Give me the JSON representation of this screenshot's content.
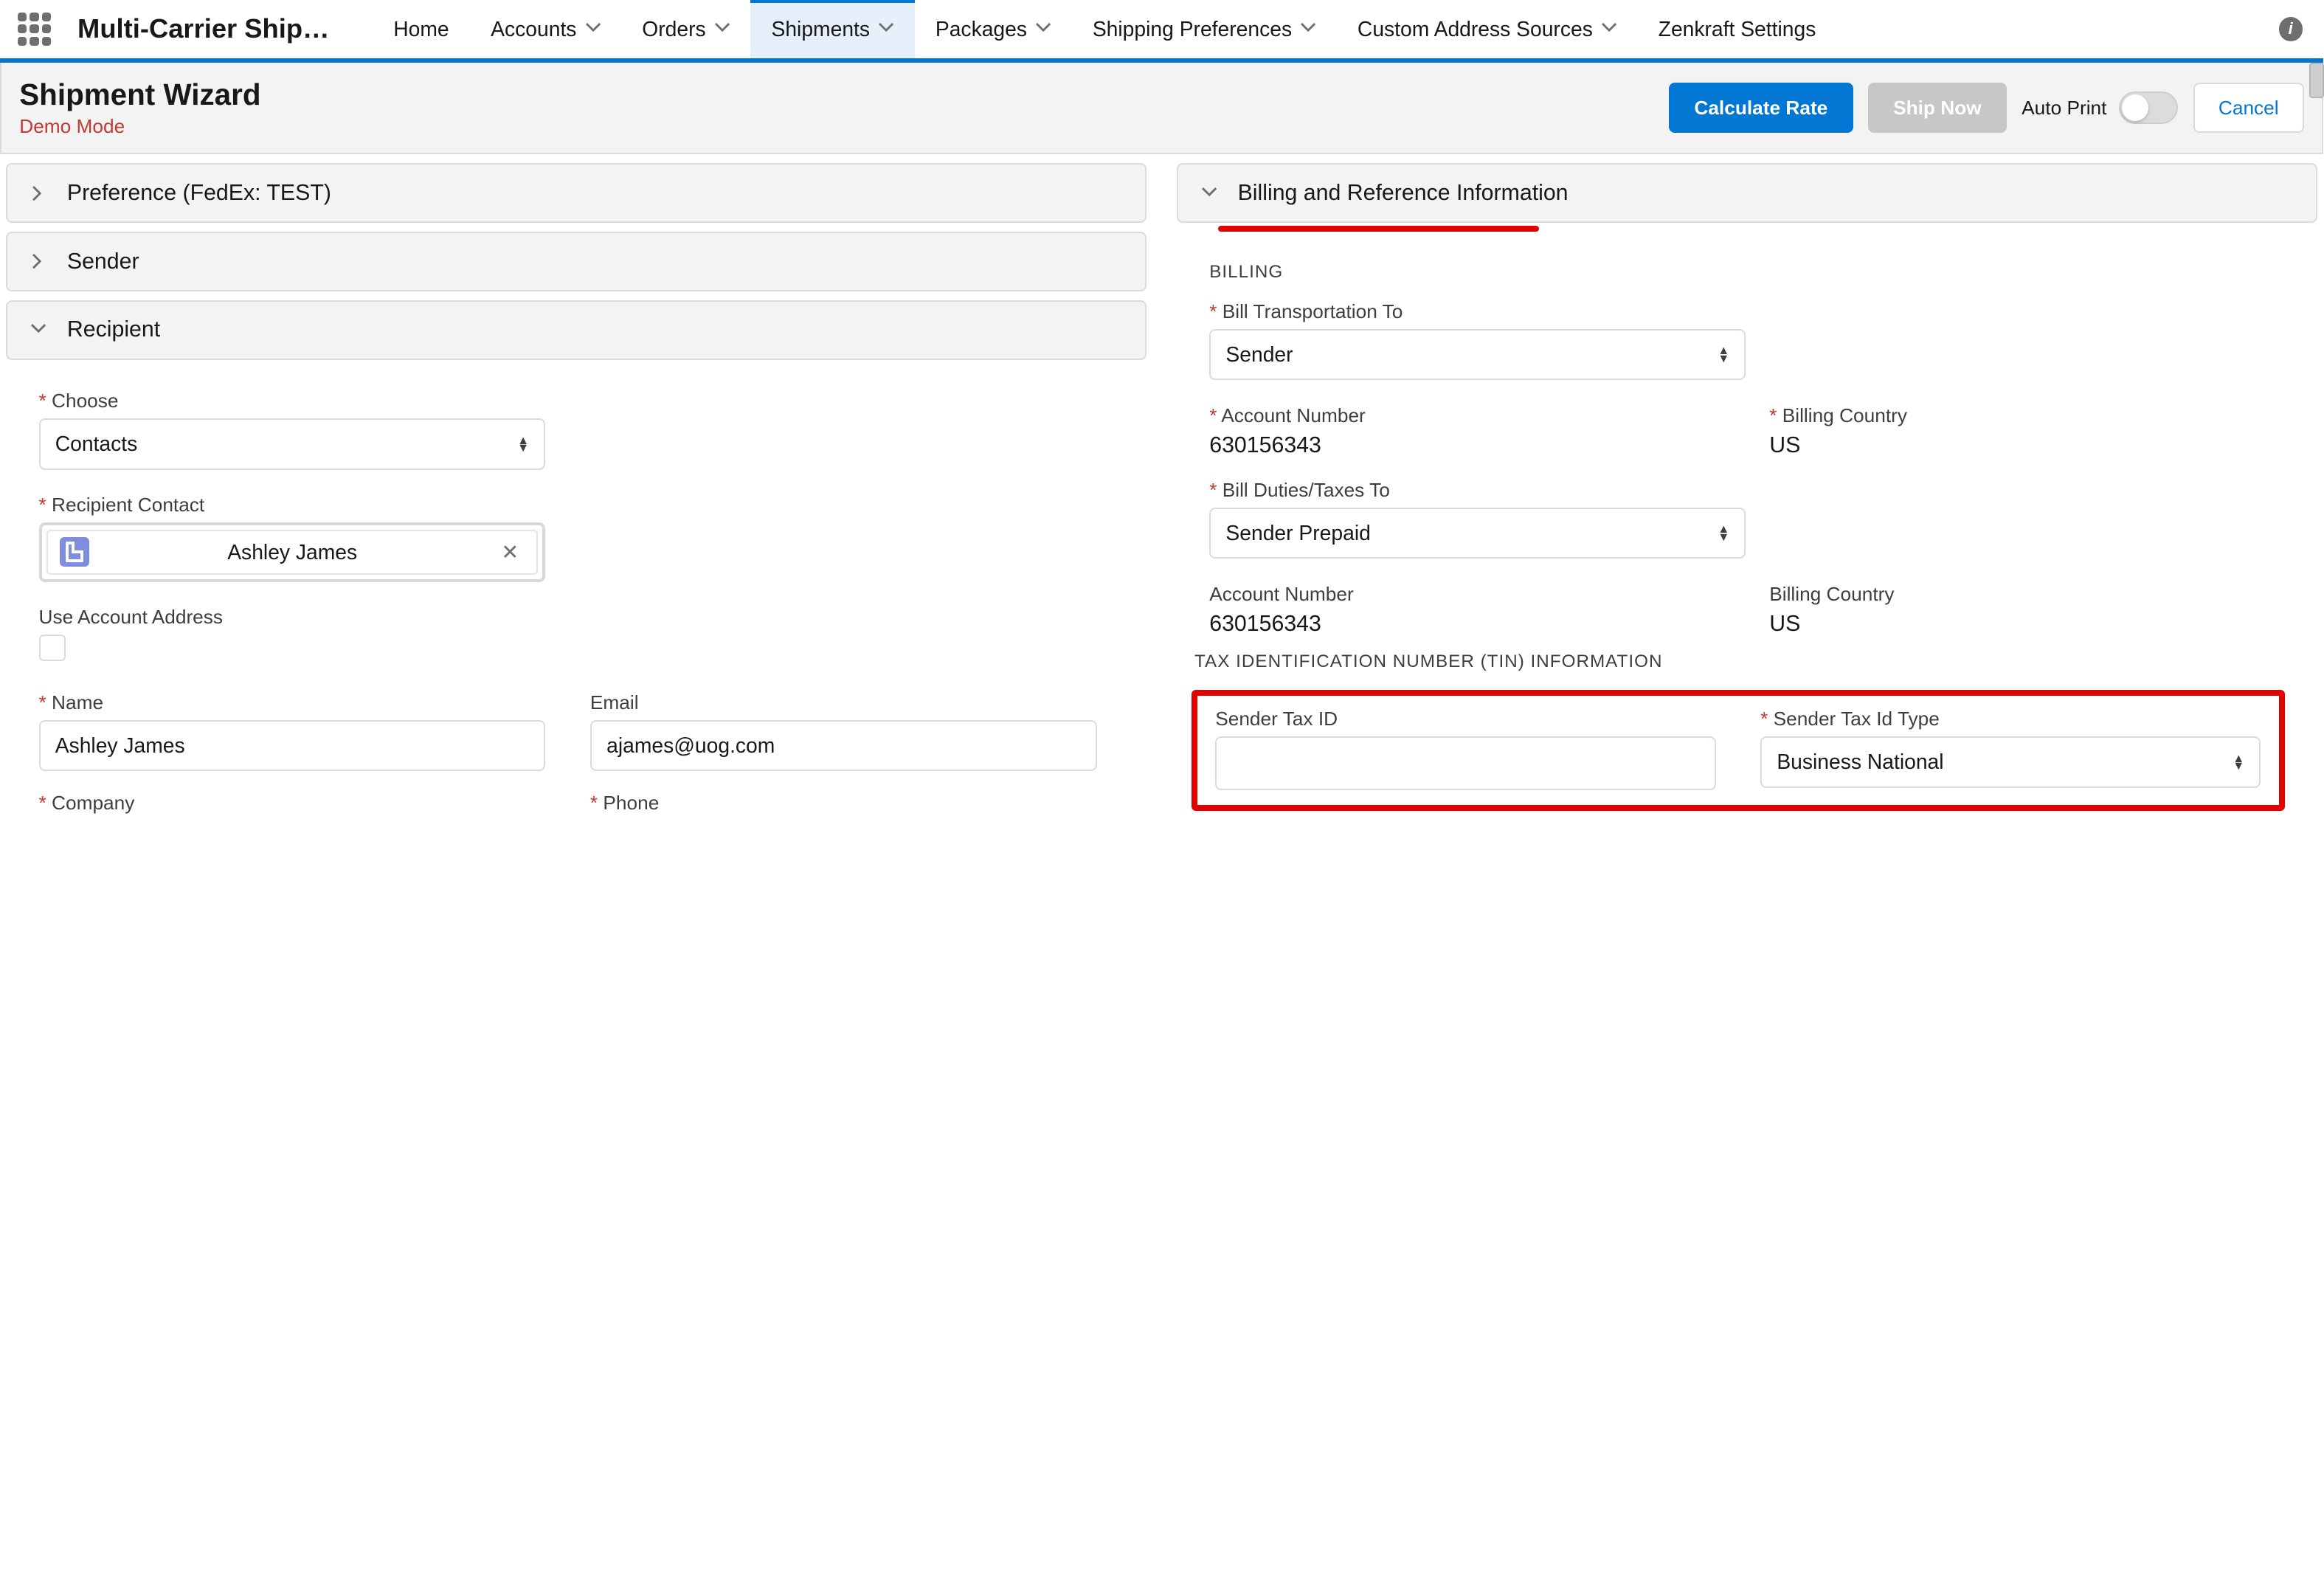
{
  "app": {
    "title": "Multi-Carrier Shippi…"
  },
  "nav": {
    "home": "Home",
    "accounts": "Accounts",
    "orders": "Orders",
    "shipments": "Shipments",
    "packages": "Packages",
    "shipping_prefs": "Shipping Preferences",
    "custom_addr": "Custom Address Sources",
    "zenkraft": "Zenkraft Settings"
  },
  "header": {
    "title": "Shipment Wizard",
    "sub": "Demo Mode",
    "calc": "Calculate Rate",
    "ship": "Ship Now",
    "autoprint": "Auto Print",
    "cancel": "Cancel"
  },
  "left": {
    "pref": "Preference (FedEx: TEST)",
    "sender": "Sender",
    "recipient": "Recipient",
    "choose_lbl": "Choose",
    "choose_val": "Contacts",
    "contact_lbl": "Recipient Contact",
    "contact_val": "Ashley James",
    "use_acct": "Use Account Address",
    "name_lbl": "Name",
    "name_val": "Ashley James",
    "email_lbl": "Email",
    "email_val": "ajames@uog.com",
    "company_lbl": "Company",
    "phone_lbl": "Phone"
  },
  "right": {
    "panel": "Billing and Reference Information",
    "billing": "BILLING",
    "bill_trans_lbl": "Bill Transportation To",
    "bill_trans_val": "Sender",
    "acct_lbl": "Account Number",
    "acct_val": "630156343",
    "bill_country_lbl": "Billing Country",
    "bill_country_val": "US",
    "bill_duties_lbl": "Bill Duties/Taxes To",
    "bill_duties_val": "Sender Prepaid",
    "acct2_lbl": "Account Number",
    "acct2_val": "630156343",
    "bill_country2_lbl": "Billing Country",
    "bill_country2_val": "US",
    "tin_title": "TAX IDENTIFICATION NUMBER (TIN) INFORMATION",
    "sender_tax_id_lbl": "Sender Tax ID",
    "sender_tax_type_lbl": "Sender Tax Id Type",
    "sender_tax_type_val": "Business National"
  }
}
